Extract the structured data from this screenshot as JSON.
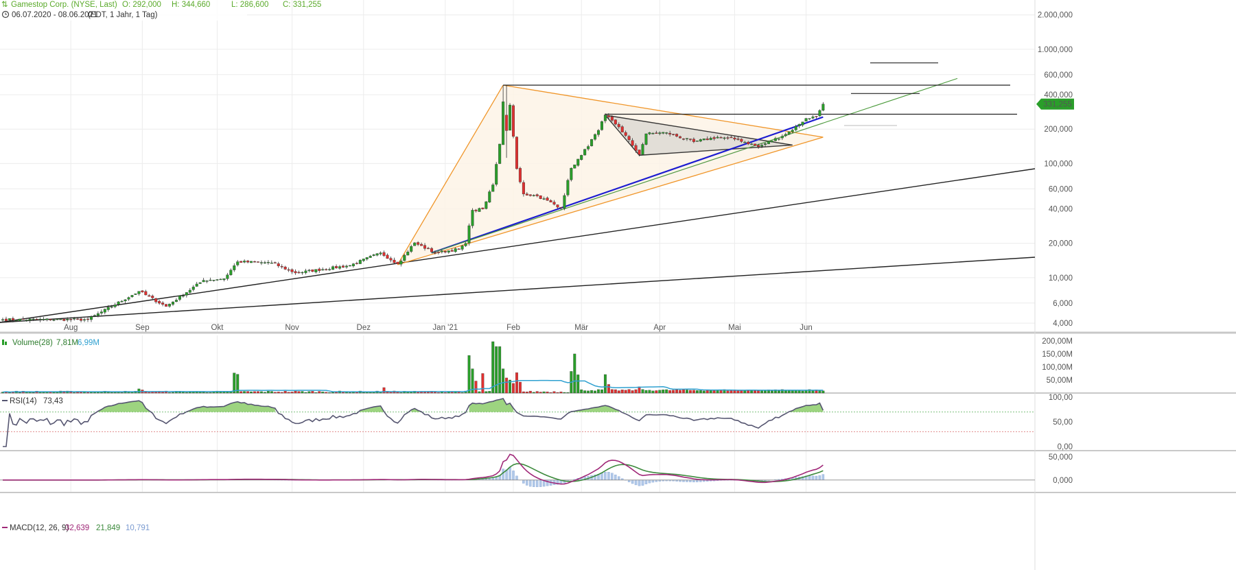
{
  "header": {
    "title": "Gamestop Corp. (NYSE, Last)",
    "ohlc": {
      "open": "O: 292,000",
      "high": "H: 344,660",
      "low": "L: 286,600",
      "close": "C: 331,255"
    },
    "range": "06.07.2020 - 08.06.2021",
    "range_info": "(EDT, 1 Jahr, 1 Tag)"
  },
  "price_badge": "331,255",
  "colors": {
    "up": "#2a9e2a",
    "down": "#e03030",
    "header_green": "#5aaa2a",
    "volume_avg": "#2ea0d0",
    "rsi": "#555570",
    "macd": "#a02878",
    "signal": "#3c8a3c",
    "hist": "#b0c8e8",
    "trend_blue": "#1c1cd0",
    "trend_orange": "#f0962a"
  },
  "chart_data": [
    {
      "type": "candlestick",
      "scale": "log",
      "x_labels": [
        "Aug",
        "Sep",
        "Okt",
        "Nov",
        "Dez",
        "Jan '21",
        "Feb",
        "Mär",
        "Apr",
        "Mai",
        "Jun"
      ],
      "y_ticks": [
        "2.000,000",
        "1.000,000",
        "600,000",
        "400,000",
        "200,000",
        "100,000",
        "60,000",
        "40,000",
        "20,000",
        "10,000",
        "6,000",
        "4,000"
      ],
      "y_tick_values": [
        2000,
        1000,
        600,
        400,
        200,
        100,
        60,
        40,
        20,
        10,
        6,
        4
      ],
      "ylim": [
        3.3,
        2700
      ],
      "last_close": 331.255,
      "close_keypoints": [
        [
          "2020-07-06",
          4.3
        ],
        [
          "2020-08-10",
          4.3
        ],
        [
          "2020-08-31",
          7.6
        ],
        [
          "2020-09-10",
          5.6
        ],
        [
          "2020-09-25",
          9.5
        ],
        [
          "2020-10-05",
          9.8
        ],
        [
          "2020-10-09",
          13.8
        ],
        [
          "2020-10-23",
          13.5
        ],
        [
          "2020-11-03",
          11.0
        ],
        [
          "2020-11-25",
          12.8
        ],
        [
          "2020-12-08",
          16.5
        ],
        [
          "2020-12-15",
          13.2
        ],
        [
          "2020-12-22",
          20.2
        ],
        [
          "2020-12-30",
          16.5
        ],
        [
          "2021-01-08",
          17.8
        ],
        [
          "2021-01-12",
          20.0
        ],
        [
          "2021-01-14",
          39.0
        ],
        [
          "2021-01-19",
          40.0
        ],
        [
          "2021-01-22",
          65.0
        ],
        [
          "2021-01-26",
          148.0
        ],
        [
          "2021-01-27",
          347.0
        ],
        [
          "2021-01-28",
          194.0
        ],
        [
          "2021-01-29",
          325.0
        ],
        [
          "2021-02-02",
          90.0
        ],
        [
          "2021-02-04",
          54.0
        ],
        [
          "2021-02-10",
          52.0
        ],
        [
          "2021-02-19",
          41.0
        ],
        [
          "2021-02-24",
          91.0
        ],
        [
          "2021-03-01",
          118.0
        ],
        [
          "2021-03-08",
          195.0
        ],
        [
          "2021-03-10",
          265.0
        ],
        [
          "2021-03-16",
          209.0
        ],
        [
          "2021-03-24",
          120.0
        ],
        [
          "2021-03-26",
          182.0
        ],
        [
          "2021-04-05",
          186.0
        ],
        [
          "2021-04-15",
          155.0
        ],
        [
          "2021-04-26",
          170.0
        ],
        [
          "2021-05-04",
          162.0
        ],
        [
          "2021-05-12",
          140.0
        ],
        [
          "2021-05-24",
          180.0
        ],
        [
          "2021-05-28",
          220.0
        ],
        [
          "2021-06-01",
          248.0
        ],
        [
          "2021-06-04",
          258.0
        ],
        [
          "2021-06-08",
          331.255
        ]
      ]
    },
    {
      "type": "bar",
      "name": "Volume(28)",
      "values_text": [
        "7,81M",
        "6,99M"
      ],
      "y_ticks": [
        "200,00M",
        "150,00M",
        "100,00M",
        "50,00M"
      ],
      "y_tick_values": [
        200,
        150,
        100,
        50
      ],
      "ylim": [
        0,
        205
      ],
      "spikes_millions": [
        [
          "2020-08-31",
          16
        ],
        [
          "2020-09-01",
          12
        ],
        [
          "2020-10-08",
          77
        ],
        [
          "2020-10-09",
          72
        ],
        [
          "2020-12-09",
          21
        ],
        [
          "2021-01-13",
          144
        ],
        [
          "2021-01-14",
          93
        ],
        [
          "2021-01-15",
          46
        ],
        [
          "2021-01-19",
          75
        ],
        [
          "2021-01-22",
          197
        ],
        [
          "2021-01-25",
          178
        ],
        [
          "2021-01-26",
          178
        ],
        [
          "2021-01-27",
          93
        ],
        [
          "2021-01-28",
          58
        ],
        [
          "2021-01-29",
          50
        ],
        [
          "2021-02-01",
          37
        ],
        [
          "2021-02-02",
          78
        ],
        [
          "2021-02-03",
          42
        ],
        [
          "2021-02-24",
          83
        ],
        [
          "2021-02-25",
          150
        ],
        [
          "2021-02-26",
          70
        ],
        [
          "2021-03-10",
          71
        ],
        [
          "2021-03-11",
          33
        ],
        [
          "2021-03-24",
          24
        ]
      ]
    },
    {
      "type": "line",
      "name": "RSI(14)",
      "value_text": "73,43",
      "y_ticks": [
        "100,00",
        "50,00",
        "0,00"
      ],
      "ylim": [
        0,
        100
      ],
      "thresholds": [
        70,
        30
      ]
    },
    {
      "type": "line",
      "name": "MACD(12, 26, 9)",
      "values_text": [
        "32,639",
        "21,849",
        "10,791"
      ],
      "y_ticks": [
        "50,000",
        "0,000"
      ],
      "ylim": [
        -12,
        57
      ]
    }
  ]
}
